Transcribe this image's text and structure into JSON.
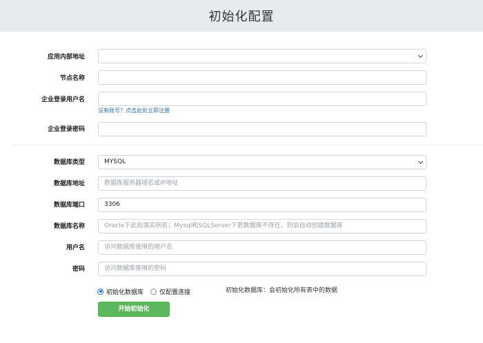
{
  "header": {
    "title": "初始化配置"
  },
  "form": {
    "app_address": {
      "label": "应用内部地址",
      "value": ""
    },
    "node_name": {
      "label": "节点名称",
      "value": ""
    },
    "enterprise_user": {
      "label": "企业登录用户名",
      "value": ""
    },
    "register_link": "没有账号？点击此处立即注册",
    "enterprise_password": {
      "label": "企业登录密码",
      "value": ""
    },
    "db_type": {
      "label": "数据库类型",
      "value": "MYSQL"
    },
    "db_address": {
      "label": "数据库地址",
      "placeholder": "数据库服务器域名或IP地址"
    },
    "db_port": {
      "label": "数据库端口",
      "value": "3306"
    },
    "db_name": {
      "label": "数据库名称",
      "placeholder": "Oracle下此处填实例名；Mysql和SQLServer下若数据库不存在，则会自动创建数据库"
    },
    "db_user": {
      "label": "用户名",
      "placeholder": "访问数据库使用的用户名"
    },
    "db_password": {
      "label": "密码",
      "placeholder": "访问数据库使用的密码"
    },
    "mode": {
      "options": [
        {
          "label": "初始化数据库",
          "checked": true
        },
        {
          "label": "仅配置连接",
          "checked": false
        }
      ],
      "hint": "初始化数据库：会初始化所有表中的数据"
    },
    "submit_label": "开始初始化"
  }
}
